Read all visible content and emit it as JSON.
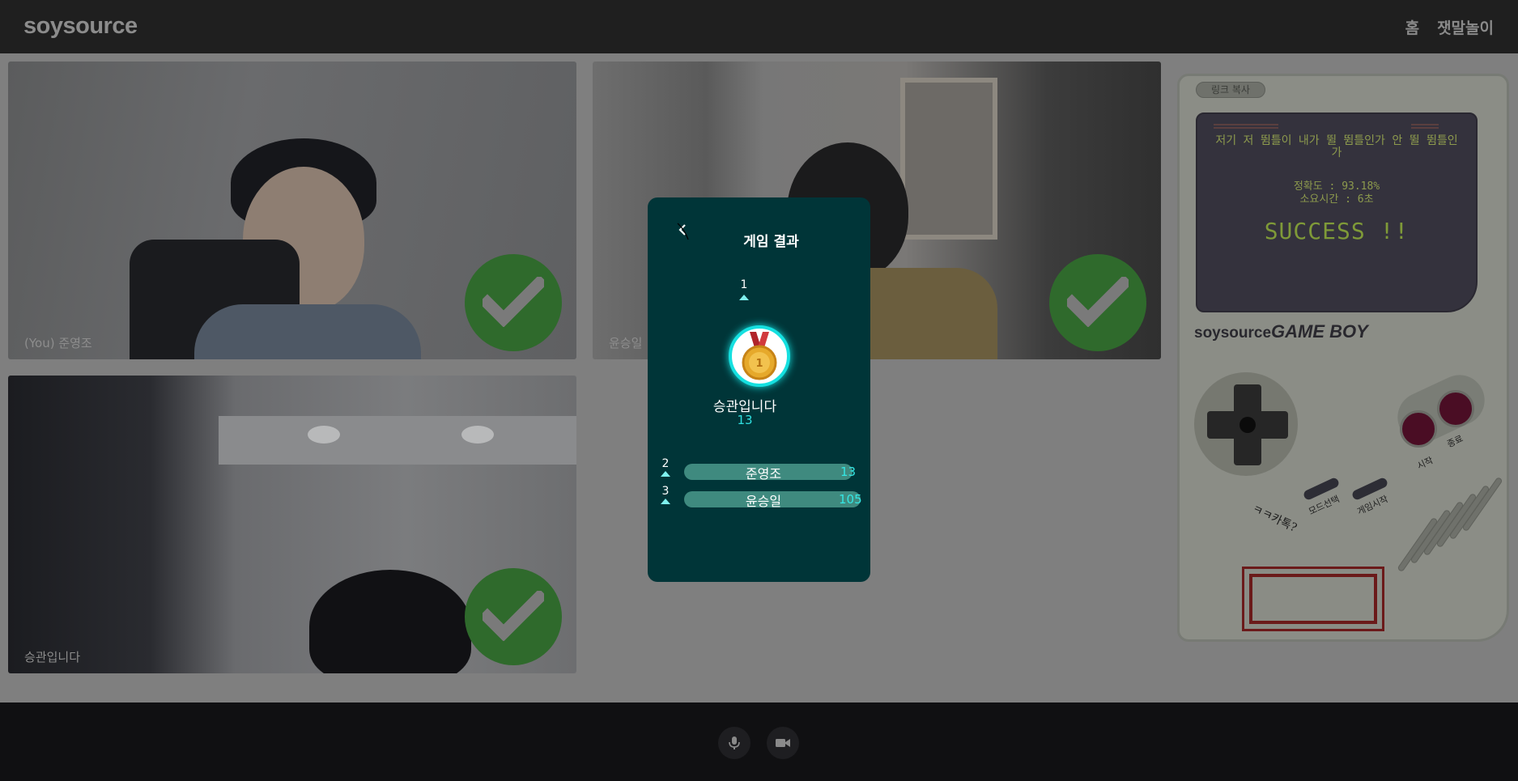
{
  "header": {
    "logo": "soysource",
    "nav": [
      "홈",
      "잿말놀이"
    ]
  },
  "videos": [
    {
      "name": "(You) 준영조",
      "status": "check"
    },
    {
      "name": "윤승일",
      "status": "check"
    },
    {
      "name": "승관입니다",
      "status": "check"
    }
  ],
  "gameboy": {
    "copy_link": "링크 복사",
    "sentence": "저기 저 뜀틀이 내가 뛸 뜀틀인가 안 뛸 뜀틀인가",
    "accuracy": "정확도 : 93.18%",
    "time": "소요시간 : 6초",
    "result": "SUCCESS !!",
    "brand_prefix": "soysource",
    "brand_suffix": "GAME BOY",
    "btn_start": "시작",
    "btn_end": "종료",
    "btn_mode": "모드선택",
    "btn_game_start": "게임시작",
    "handwriting": "ㅋㅋ카톡?"
  },
  "result_modal": {
    "title": "게임 결과",
    "first": {
      "rank": "1",
      "name": "승관입니다",
      "score": "13"
    },
    "others": [
      {
        "rank": "2",
        "name": "준영조",
        "score": "13"
      },
      {
        "rank": "3",
        "name": "윤승일",
        "score": "105"
      }
    ]
  },
  "colors": {
    "modal_bg": "#003538",
    "accent": "#15e0e0",
    "check_green": "#2f6a2c"
  },
  "icons": [
    "back-arrow-icon",
    "medal-icon",
    "check-icon",
    "mic-icon",
    "camera-icon"
  ]
}
